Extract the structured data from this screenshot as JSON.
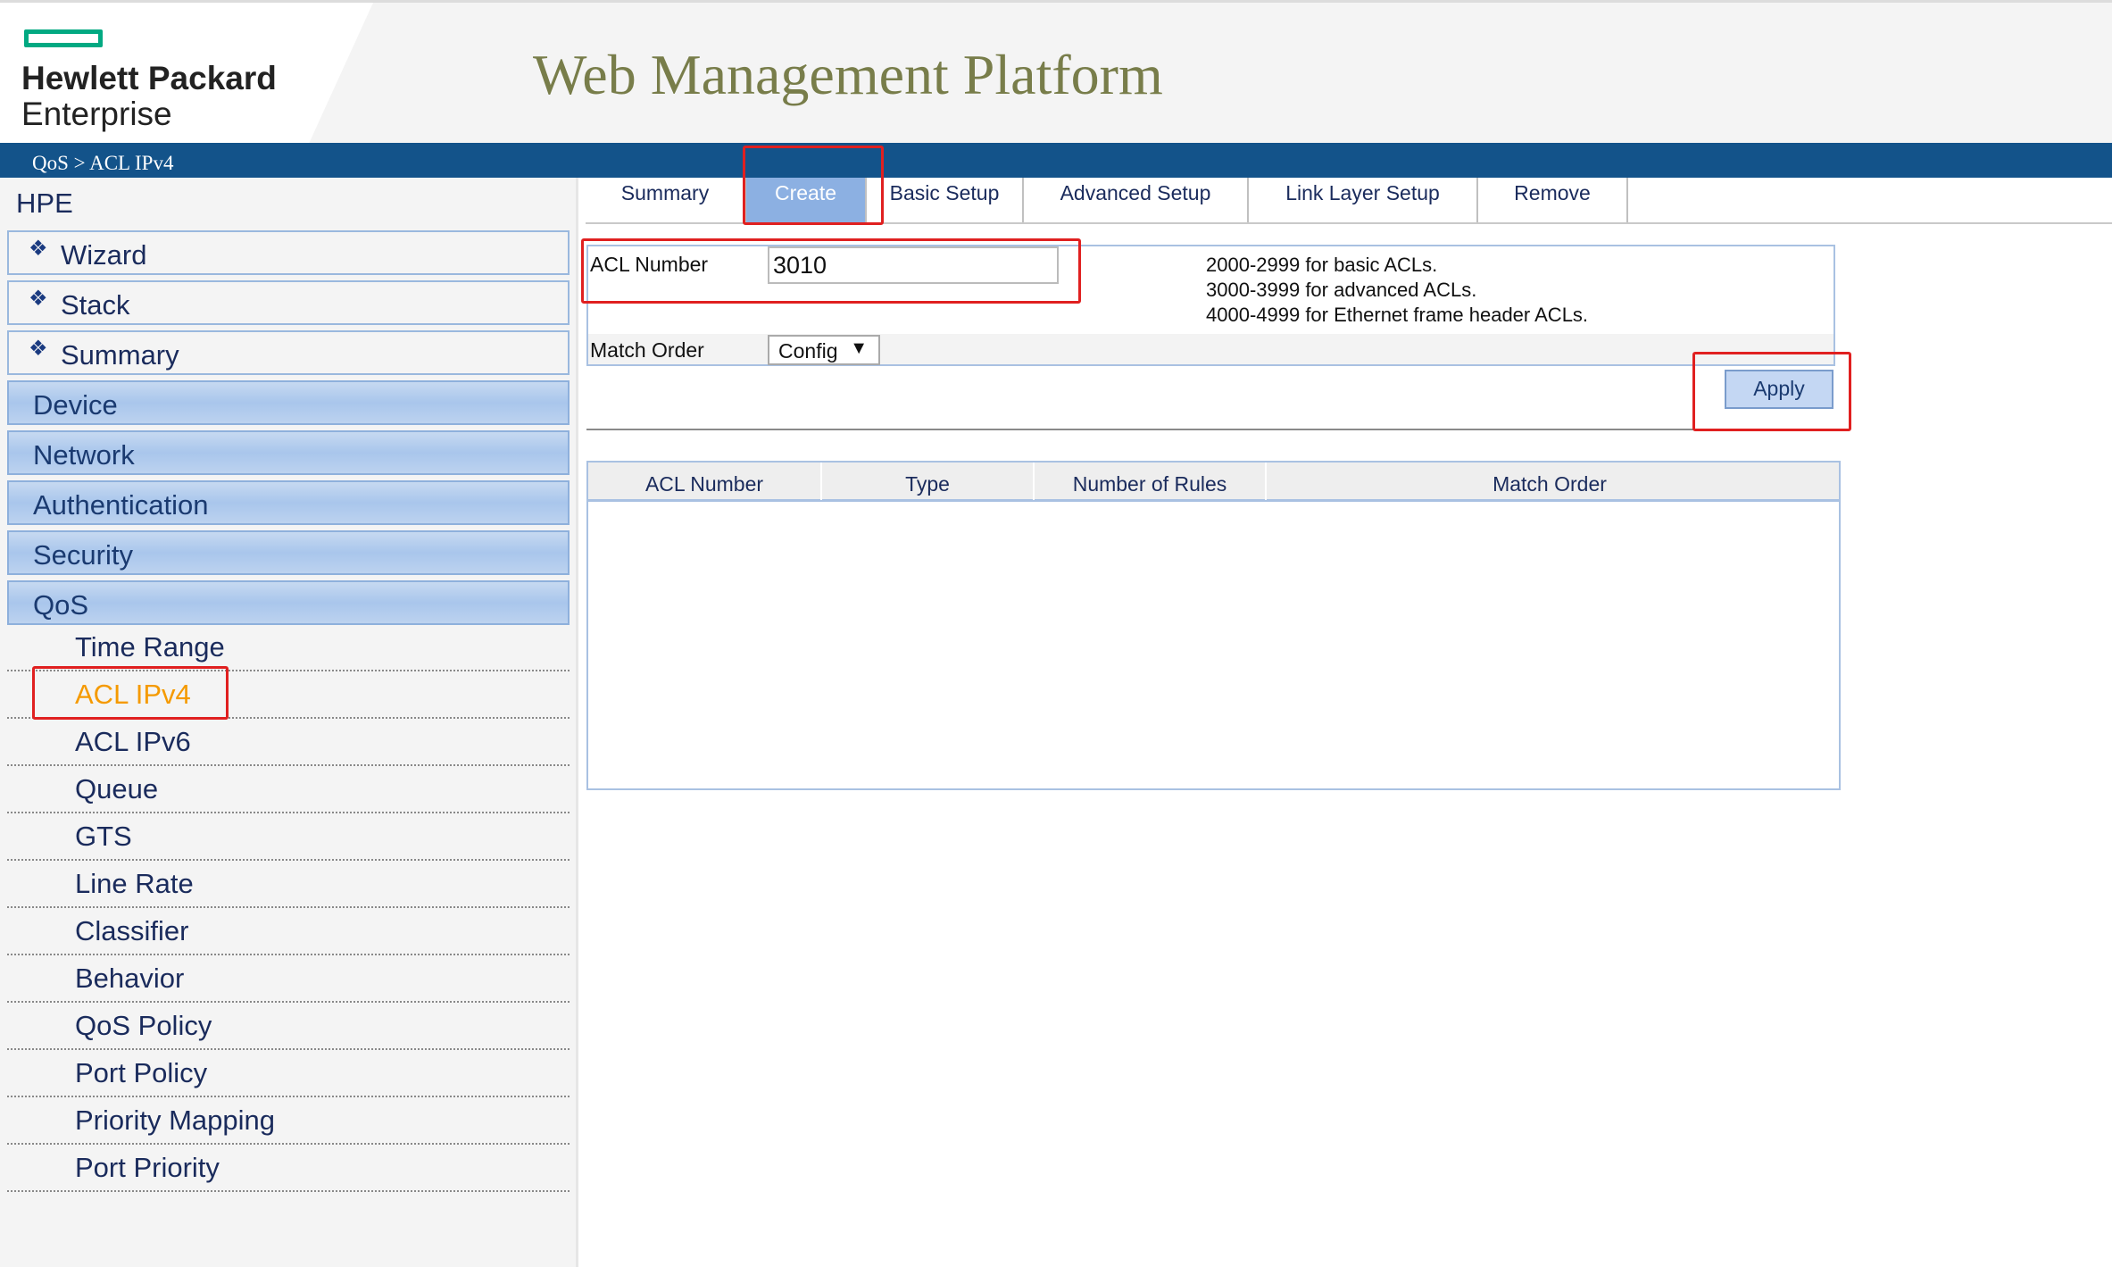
{
  "header": {
    "brand_line1": "Hewlett Packard",
    "brand_line2": "Enterprise",
    "title": "Web Management Platform",
    "brand_color": "#01a982",
    "title_color": "#787d4a"
  },
  "breadcrumb": "QoS > ACL IPv4",
  "sidebar": {
    "root": "HPE",
    "top_items": [
      {
        "label": "Wizard",
        "icon": "diamond-icon"
      },
      {
        "label": "Stack",
        "icon": "diamond-icon"
      },
      {
        "label": "Summary",
        "icon": "diamond-icon"
      }
    ],
    "categories": [
      "Device",
      "Network",
      "Authentication",
      "Security",
      "QoS"
    ],
    "qos_items": [
      "Time Range",
      "ACL IPv4",
      "ACL IPv6",
      "Queue",
      "GTS",
      "Line Rate",
      "Classifier",
      "Behavior",
      "QoS Policy",
      "Port Policy",
      "Priority Mapping",
      "Port Priority"
    ],
    "active_item": "ACL IPv4",
    "active_color": "#f59a00"
  },
  "tabs": {
    "items": [
      "Summary",
      "Create",
      "Basic Setup",
      "Advanced Setup",
      "Link Layer Setup",
      "Remove"
    ],
    "active": "Create"
  },
  "form": {
    "acl_number_label": "ACL Number",
    "acl_number_value": "3010",
    "hints": [
      "2000-2999 for basic ACLs.",
      "3000-3999 for advanced ACLs.",
      "4000-4999 for Ethernet frame header ACLs."
    ],
    "match_order_label": "Match Order",
    "match_order_value": "Config",
    "match_order_arrow": "▼",
    "apply_label": "Apply"
  },
  "table": {
    "columns": [
      "ACL Number",
      "Type",
      "Number of Rules",
      "Match Order"
    ],
    "rows": []
  },
  "highlight_color": "#e02020"
}
